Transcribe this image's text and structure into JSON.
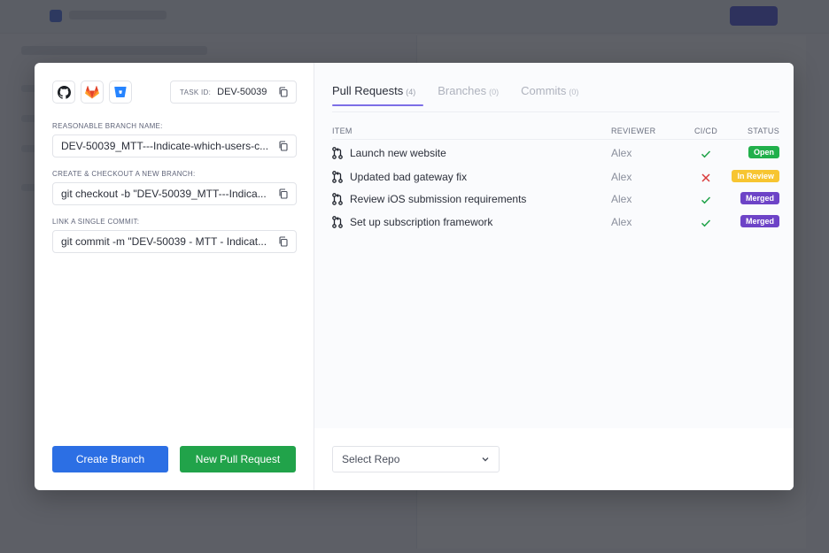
{
  "task": {
    "label": "TASK ID:",
    "id": "DEV-50039"
  },
  "providers": [
    "github-icon",
    "gitlab-icon",
    "bitbucket-icon"
  ],
  "fields": [
    {
      "label": "REASONABLE BRANCH NAME:",
      "value": "DEV-50039_MTT---Indicate-which-users-c..."
    },
    {
      "label": "CREATE & CHECKOUT A NEW BRANCH:",
      "value": "git checkout -b \"DEV-50039_MTT---Indica..."
    },
    {
      "label": "LINK A SINGLE COMMIT:",
      "value": "git commit -m \"DEV-50039 - MTT - Indicat..."
    }
  ],
  "buttons": {
    "create_branch": "Create Branch",
    "new_pull_request": "New Pull Request"
  },
  "tabs": [
    {
      "label": "Pull Requests",
      "count": "(4)"
    },
    {
      "label": "Branches",
      "count": "(0)"
    },
    {
      "label": "Commits",
      "count": "(0)"
    }
  ],
  "table": {
    "headers": {
      "item": "ITEM",
      "reviewer": "REVIEWER",
      "cicd": "CI/CD",
      "status": "STATUS"
    },
    "rows": [
      {
        "title": "Launch new website",
        "reviewer": "Alex",
        "ci": "pass",
        "status": "Open"
      },
      {
        "title": "Updated bad gateway fix",
        "reviewer": "Alex",
        "ci": "fail",
        "status": "In Review"
      },
      {
        "title": "Review iOS submission requirements",
        "reviewer": "Alex",
        "ci": "pass",
        "status": "Merged"
      },
      {
        "title": "Set up subscription framework",
        "reviewer": "Alex",
        "ci": "pass",
        "status": "Merged"
      }
    ]
  },
  "repo_select": {
    "value": "Select Repo"
  },
  "colors": {
    "primary": "#2c6fe4",
    "success": "#21a34a",
    "accent": "#7c6ee6",
    "open": "#21b04b",
    "in_review": "#f7c531",
    "merged": "#6d43c7",
    "fail": "#d93a3a"
  }
}
